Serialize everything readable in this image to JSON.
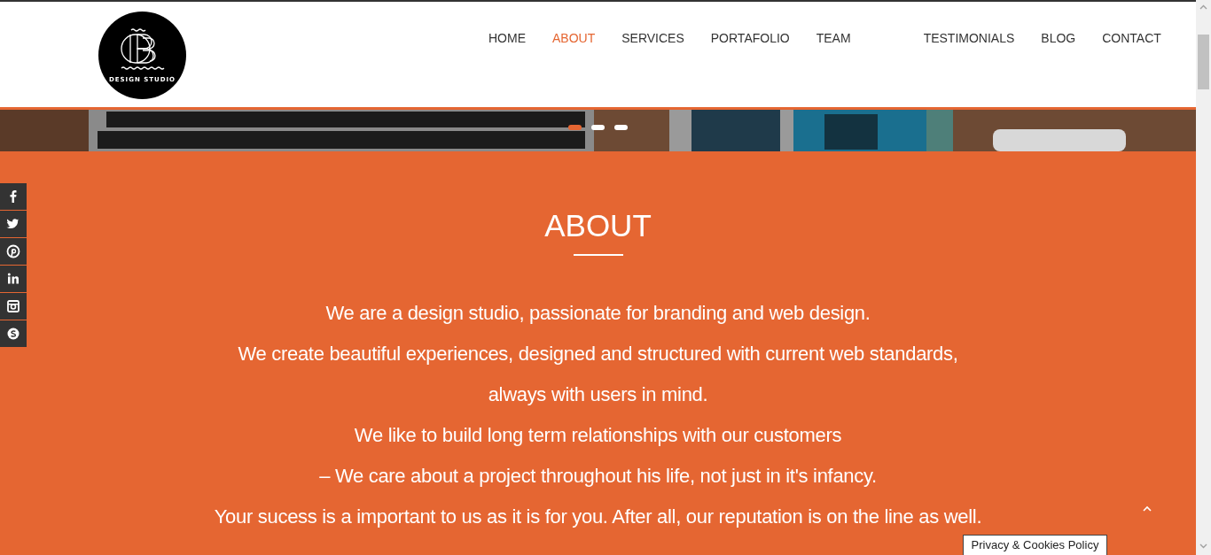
{
  "logo": {
    "caption": "DESIGN STUDIO"
  },
  "nav": [
    {
      "label": "HOME",
      "selected": false
    },
    {
      "label": "ABOUT",
      "selected": true
    },
    {
      "label": "SERVICES",
      "selected": false
    },
    {
      "label": "PORTAFOLIO",
      "selected": false
    },
    {
      "label": "TEAM",
      "selected": false
    },
    {
      "label": "TESTIMONIALS",
      "selected": false
    },
    {
      "label": "BLOG",
      "selected": false
    },
    {
      "label": "CONTACT",
      "selected": false
    }
  ],
  "slider_dots": [
    {
      "selected": true
    },
    {
      "selected": false
    },
    {
      "selected": false
    }
  ],
  "about": {
    "title": "ABOUT",
    "lines": [
      "We are a design studio, passionate for branding and web design.",
      "We create beautiful experiences, designed and structured with current web standards,",
      "always with users in mind.",
      "We like to build long term relationships with our customers",
      "– We care about a project throughout his life, not just in it's infancy.",
      "Your sucess is a important to us as it is for you. After all, our reputation is on the line as well."
    ]
  },
  "privacy_button": "Privacy & Cookies Policy"
}
